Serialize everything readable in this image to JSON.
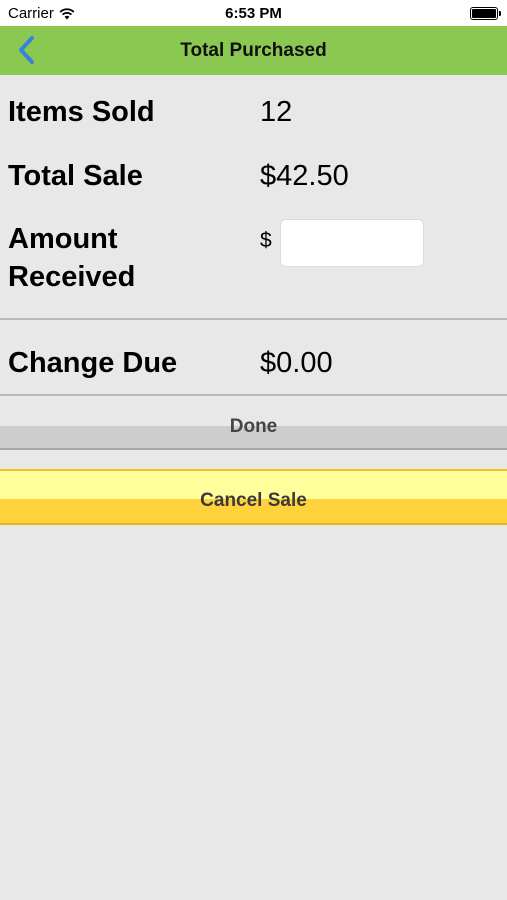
{
  "status_bar": {
    "carrier": "Carrier",
    "time": "6:53 PM",
    "wifi_icon": "wifi-icon",
    "battery_icon": "battery-full-icon"
  },
  "nav": {
    "title": "Total Purchased",
    "back_icon": "chevron-left-icon",
    "accent_color": "#8bc852",
    "back_color": "#3a82d6"
  },
  "sale": {
    "items_sold_label": "Items Sold",
    "items_sold_value": "12",
    "total_sale_label": "Total Sale",
    "total_sale_value": "$42.50",
    "amount_received_label": "Amount Received",
    "amount_currency": "$",
    "amount_received_value": "",
    "change_due_label": "Change Due",
    "change_due_value": "$0.00"
  },
  "actions": {
    "done_label": "Done",
    "cancel_label": "Cancel Sale",
    "cancel_color": "#ffd23c"
  }
}
